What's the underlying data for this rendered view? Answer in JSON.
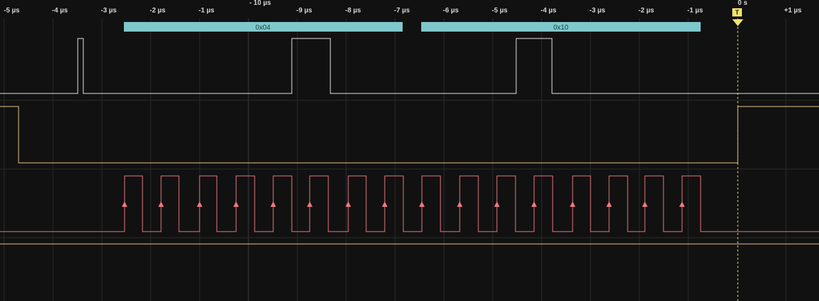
{
  "timeline": {
    "tick_labels": [
      "-5 µs",
      "-4 µs",
      "-3 µs",
      "-2 µs",
      "-1 µs",
      "-9 µs",
      "-8 µs",
      "-7 µs",
      "-6 µs",
      "-5 µs",
      "-4 µs",
      "-3 µs",
      "-2 µs",
      "-1 µs",
      "+1 µs"
    ],
    "major_label": "- 10 µs",
    "zero_label": "0 s",
    "trigger_marker": "T"
  },
  "decoder": {
    "color": "#7ec8cb",
    "frames": [
      {
        "label": "0x04"
      },
      {
        "label": "0x10"
      }
    ]
  },
  "channels": {
    "data_color": "#e8e8e8",
    "enable_color": "#f0c890",
    "clock_color": "#f07882",
    "trigger_color": "#f2e26a"
  }
}
